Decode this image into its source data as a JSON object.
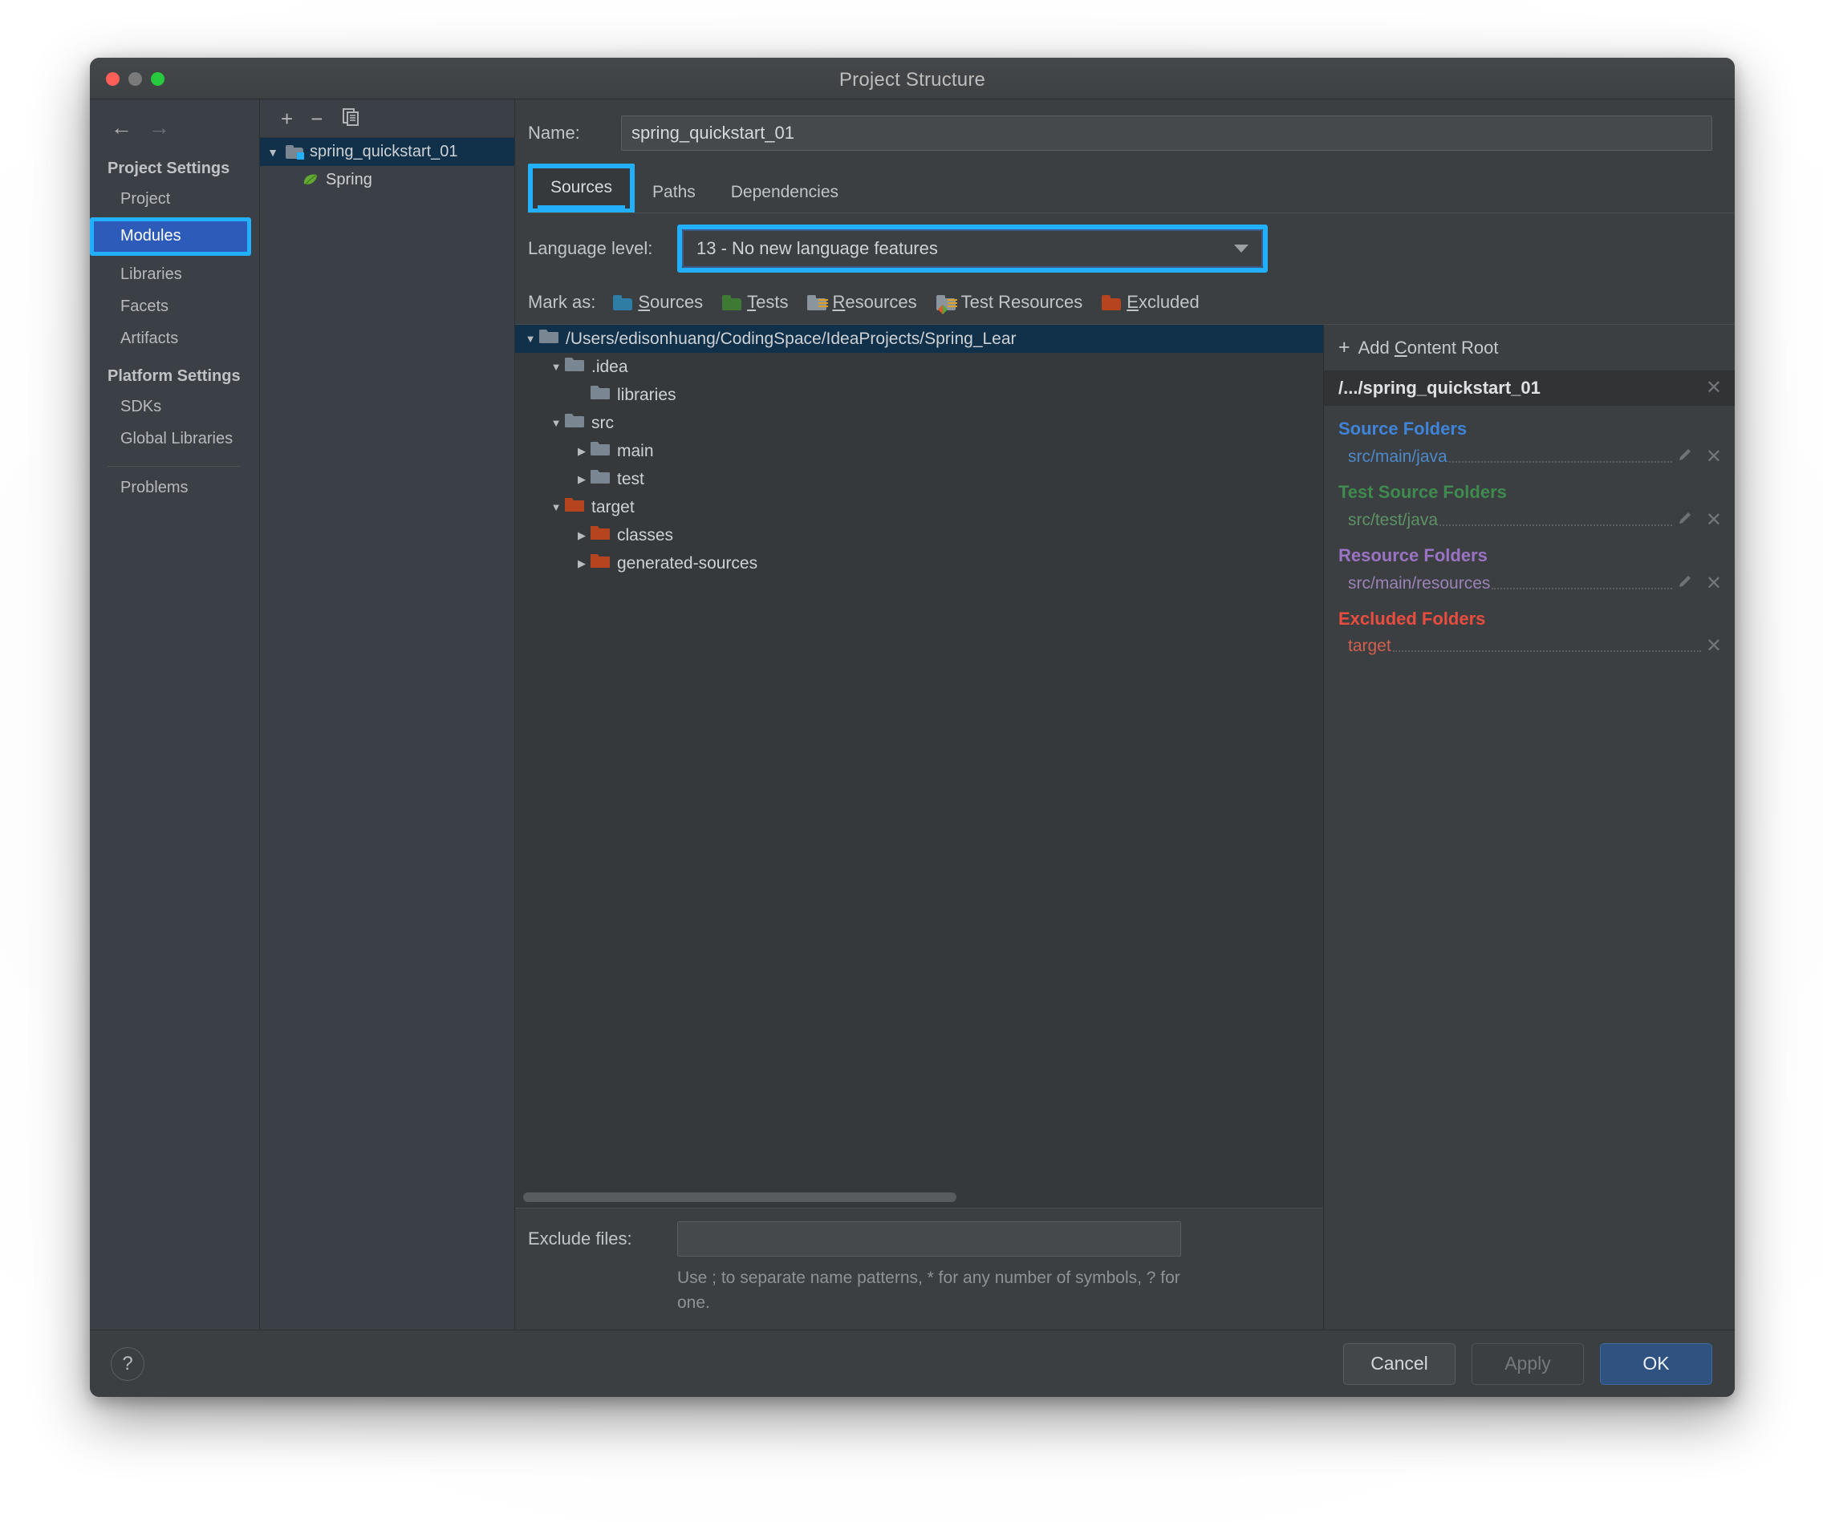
{
  "window": {
    "title": "Project Structure",
    "traffic_lights": [
      "close",
      "minimize",
      "maximize"
    ]
  },
  "sidebar": {
    "back_icon": "←",
    "forward_icon": "→",
    "groups": [
      {
        "title": "Project Settings",
        "items": [
          {
            "label": "Project",
            "selected": false
          },
          {
            "label": "Modules",
            "selected": true,
            "highlighted": true
          },
          {
            "label": "Libraries",
            "selected": false
          },
          {
            "label": "Facets",
            "selected": false
          },
          {
            "label": "Artifacts",
            "selected": false
          }
        ]
      },
      {
        "title": "Platform Settings",
        "items": [
          {
            "label": "SDKs",
            "selected": false
          },
          {
            "label": "Global Libraries",
            "selected": false
          }
        ]
      }
    ],
    "footer_items": [
      {
        "label": "Problems"
      }
    ]
  },
  "module_panel": {
    "toolbar": {
      "add_label": "+",
      "remove_label": "−",
      "copy_label": "copy-icon"
    },
    "tree": [
      {
        "label": "spring_quickstart_01",
        "caret": "▼",
        "icon": "module-folder-icon",
        "selected": true,
        "depth": 0
      },
      {
        "label": "Spring",
        "caret": "",
        "icon": "spring-leaf-icon",
        "selected": false,
        "depth": 1
      }
    ]
  },
  "main": {
    "name_label": "Name:",
    "name_value": "spring_quickstart_01",
    "tabs": [
      {
        "label": "Sources",
        "active": true,
        "highlighted": true
      },
      {
        "label": "Paths",
        "active": false,
        "highlighted": false
      },
      {
        "label": "Dependencies",
        "active": false,
        "highlighted": false
      }
    ],
    "language_level_label": "Language level:",
    "language_level_value": "13 - No new language features",
    "language_level_highlighted": true,
    "mark_as_label": "Mark as:",
    "mark_as_items": [
      {
        "label": "Sources",
        "mnemonic": "S",
        "icon": "folder-sources-icon",
        "color": "#2f7da5"
      },
      {
        "label": "Tests",
        "mnemonic": "T",
        "icon": "folder-tests-icon",
        "color": "#3f7a34"
      },
      {
        "label": "Resources",
        "mnemonic": "R",
        "icon": "folder-resources-icon",
        "color": "#8a959e"
      },
      {
        "label": "Test Resources",
        "mnemonic": "",
        "icon": "folder-test-resources-icon",
        "color": "#8a959e"
      },
      {
        "label": "Excluded",
        "mnemonic": "E",
        "icon": "folder-excluded-icon",
        "color": "#b5441f"
      }
    ],
    "file_tree": [
      {
        "label": "/Users/edisonhuang/CodingSpace/IdeaProjects/Spring_Lear",
        "caret": "▼",
        "depth": 0,
        "icon": "folder-gray-icon",
        "selected": true
      },
      {
        "label": ".idea",
        "caret": "▼",
        "depth": 1,
        "icon": "folder-gray-icon",
        "selected": false
      },
      {
        "label": "libraries",
        "caret": "",
        "depth": 2,
        "icon": "folder-gray-icon",
        "selected": false
      },
      {
        "label": "src",
        "caret": "▼",
        "depth": 1,
        "icon": "folder-gray-icon",
        "selected": false
      },
      {
        "label": "main",
        "caret": "▶",
        "depth": 2,
        "icon": "folder-gray-icon",
        "selected": false
      },
      {
        "label": "test",
        "caret": "▶",
        "depth": 2,
        "icon": "folder-gray-icon",
        "selected": false
      },
      {
        "label": "target",
        "caret": "▼",
        "depth": 1,
        "icon": "folder-orange-icon",
        "selected": false
      },
      {
        "label": "classes",
        "caret": "▶",
        "depth": 2,
        "icon": "folder-orange-icon",
        "selected": false
      },
      {
        "label": "generated-sources",
        "caret": "▶",
        "depth": 2,
        "icon": "folder-orange-icon",
        "selected": false
      }
    ],
    "exclude_files_label": "Exclude files:",
    "exclude_files_value": "",
    "exclude_files_hint": "Use ; to separate name patterns, * for any number of symbols, ? for one."
  },
  "detail_panel": {
    "add_content_root_label": "Add Content Root",
    "add_content_root_mnemonic": "C",
    "content_root_path": "/.../spring_quickstart_01",
    "groups": [
      {
        "title": "Source Folders",
        "color": "#3f84d8",
        "entries": [
          {
            "path": "src/main/java",
            "has_edit": true,
            "has_remove": true
          }
        ]
      },
      {
        "title": "Test Source Folders",
        "color": "#3f8b4f",
        "entries": [
          {
            "path": "src/test/java",
            "has_edit": true,
            "has_remove": true
          }
        ]
      },
      {
        "title": "Resource Folders",
        "color": "#9b73c4",
        "entries": [
          {
            "path": "src/main/resources",
            "has_edit": true,
            "has_remove": true
          }
        ]
      },
      {
        "title": "Excluded Folders",
        "color": "#e84d3f",
        "entries": [
          {
            "path": "target",
            "has_edit": false,
            "has_remove": true
          }
        ]
      }
    ]
  },
  "footer": {
    "help_label": "?",
    "cancel_label": "Cancel",
    "apply_label": "Apply",
    "ok_label": "OK"
  },
  "highlight_color": "#22b0fc"
}
